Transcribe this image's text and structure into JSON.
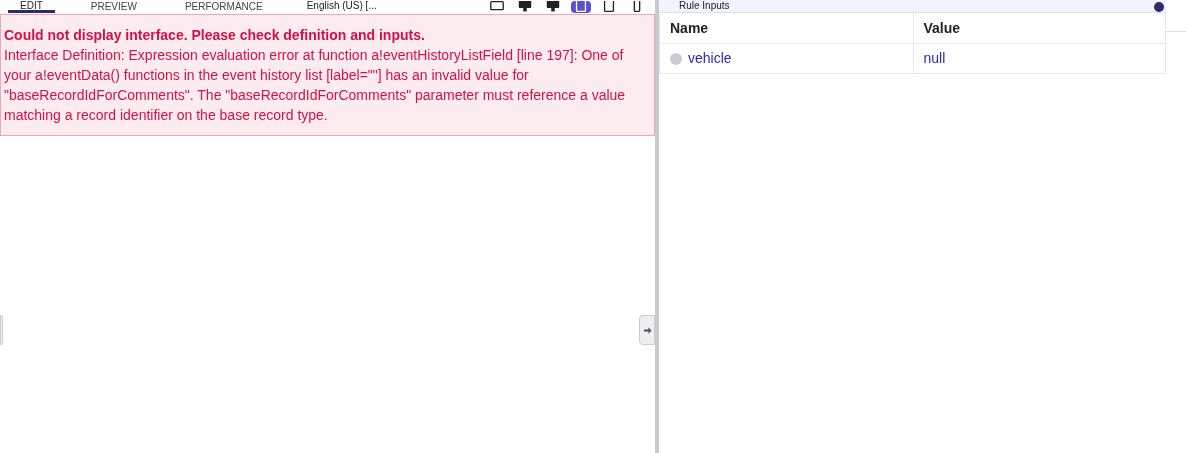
{
  "toolbar": {
    "tabs": [
      {
        "label": "EDIT",
        "selected": true
      },
      {
        "label": "PREVIEW",
        "selected": false
      },
      {
        "label": "PERFORMANCE",
        "selected": false
      }
    ],
    "locale": "English (US) [...",
    "device_icons": [
      {
        "kind": "keyboard",
        "selected": false
      },
      {
        "kind": "desktop",
        "selected": false
      },
      {
        "kind": "desktop",
        "selected": false
      },
      {
        "kind": "tablet",
        "selected": true
      },
      {
        "kind": "tablet",
        "selected": false
      },
      {
        "kind": "phone",
        "selected": false
      }
    ]
  },
  "error": {
    "title": "Could not display interface. Please check definition and inputs.",
    "message": "Interface Definition: Expression evaluation error at function a!eventHistoryListField [line 197]: One of your a!eventData() functions in the event history list [label=\"\"] has an invalid value for \"baseRecordIdForComments\". The \"baseRecordIdForComments\" parameter must reference a value matching a record identifier on the base record type."
  },
  "rule_inputs": {
    "title": "Rule Inputs",
    "columns": [
      "Name",
      "Value"
    ],
    "rows": [
      {
        "name": "vehicle",
        "value": "null"
      }
    ]
  }
}
